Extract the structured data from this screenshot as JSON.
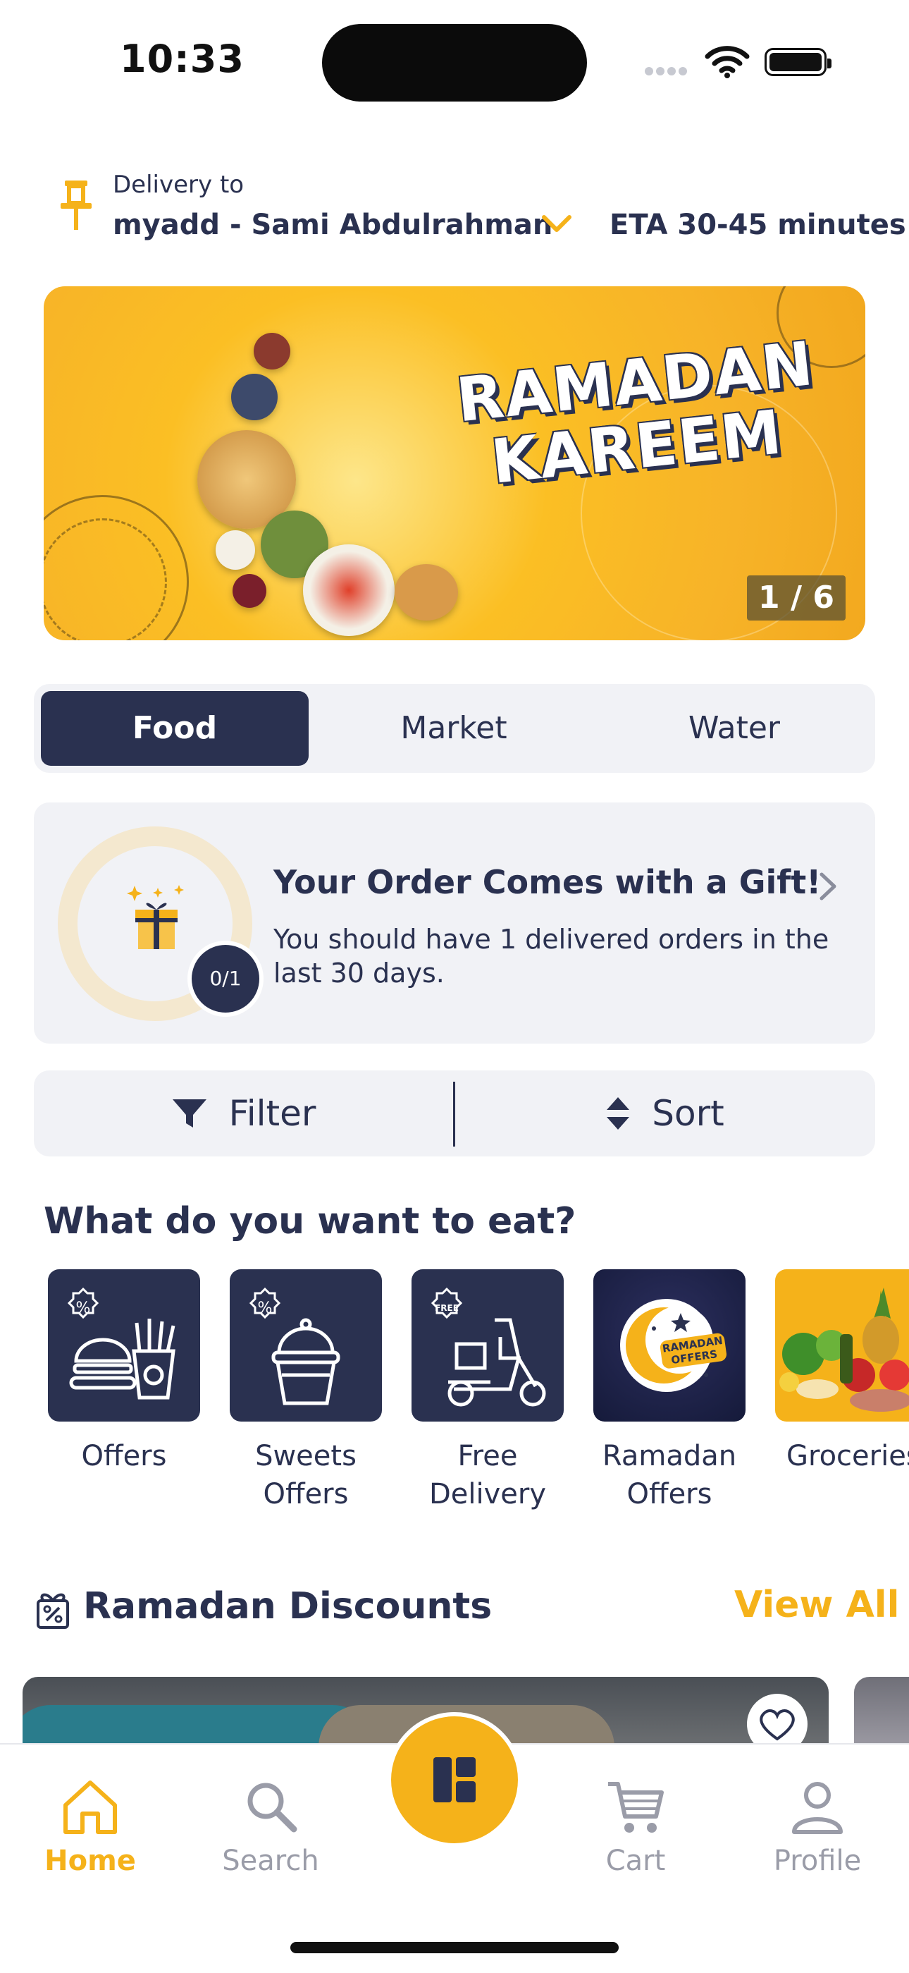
{
  "status_bar": {
    "time": "10:33"
  },
  "delivery": {
    "label": "Delivery to",
    "address": "myadd - Sami Abdulrahman",
    "eta": "ETA 30-45 minutes"
  },
  "banner": {
    "headline_line1": "RAMADAN",
    "headline_line2": "KAREEM",
    "counter": "1 / 6"
  },
  "tabs": [
    {
      "label": "Food",
      "active": true
    },
    {
      "label": "Market",
      "active": false
    },
    {
      "label": "Water",
      "active": false
    }
  ],
  "gift_card": {
    "title": "Your Order Comes with a Gift!",
    "description": "You should have 1 delivered orders in the last 30 days.",
    "progress": "0/1"
  },
  "filter_sort": {
    "filter_label": "Filter",
    "sort_label": "Sort"
  },
  "categories_section": {
    "title": "What do you want to eat?",
    "items": [
      {
        "label": "Offers",
        "icon": "burger-fries-icon",
        "badge": "%"
      },
      {
        "label": "Sweets Offers",
        "icon": "cupcake-icon",
        "badge": "%"
      },
      {
        "label": "Free Delivery",
        "icon": "scooter-icon",
        "badge": "FREE"
      },
      {
        "label": "Ramadan Offers",
        "icon": "ramadan-offers-image",
        "badge_line1": "RAMADAN",
        "badge_line2": "OFFERS"
      },
      {
        "label": "Groceries",
        "icon": "groceries-image"
      }
    ]
  },
  "ramadan_discounts": {
    "title": "Ramadan Discounts",
    "view_all": "View All"
  },
  "bottom_nav": {
    "items": [
      {
        "label": "Home",
        "icon": "home-icon",
        "active": true
      },
      {
        "label": "Search",
        "icon": "search-icon",
        "active": false
      },
      {
        "label": "Cart",
        "icon": "cart-icon",
        "active": false
      },
      {
        "label": "Profile",
        "icon": "profile-icon",
        "active": false
      }
    ]
  },
  "colors": {
    "primary_navy": "#2a3150",
    "accent_yellow": "#f5b21a",
    "surface": "#f1f2f6"
  }
}
